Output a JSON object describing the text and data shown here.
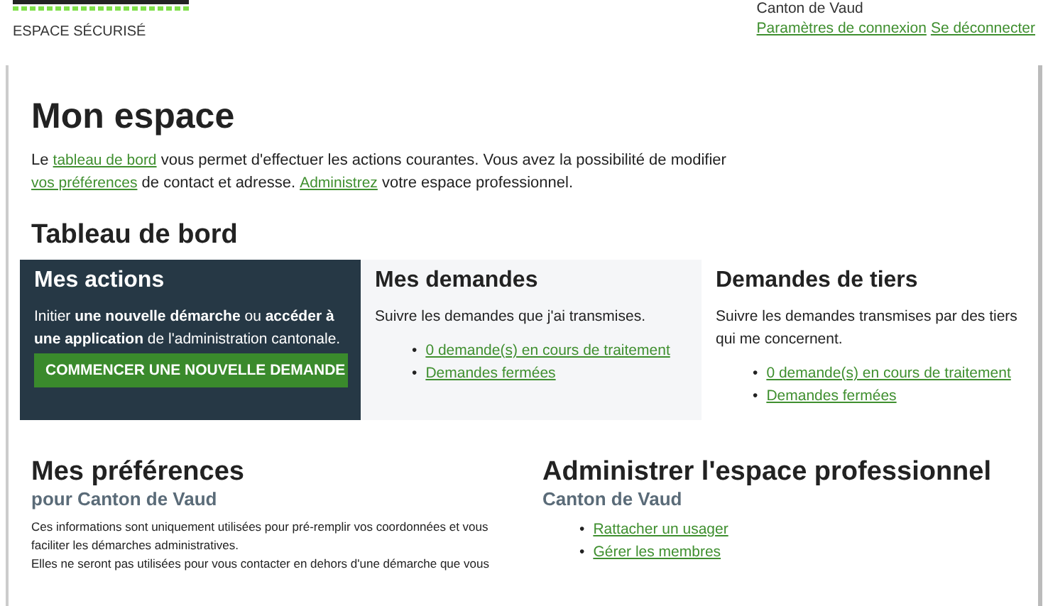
{
  "header": {
    "subtitle": "ESPACE SÉCURISÉ",
    "account": "Canton de Vaud",
    "links": [
      "Paramètres de connexion",
      "Se déconnecter"
    ]
  },
  "title": "Mon espace",
  "intro": [
    {
      "kind": "text",
      "text": "Le "
    },
    {
      "kind": "link",
      "text": "tableau de bord"
    },
    {
      "kind": "text",
      "text": " vous permet d'effectuer les actions courantes. Vous avez la possibilité de modifier "
    },
    {
      "kind": "link",
      "text": "vos préférences"
    },
    {
      "kind": "text",
      "text": " de contact et adresse. "
    },
    {
      "kind": "link",
      "text": "Administrez"
    },
    {
      "kind": "text",
      "text": " votre espace professionnel."
    }
  ],
  "dashboard": {
    "title": "Tableau de bord",
    "cards": [
      {
        "kind": "action",
        "title": "Mes actions",
        "text": "Initier **une nouvelle démarche** ou **accéder à une application** de l'administration cantonale.",
        "button": "COMMENCER UNE NOUVELLE DEMANDE"
      },
      {
        "kind": "links",
        "title": "Mes demandes",
        "text": "Suivre les demandes que j'ai transmises.",
        "bullet": "•",
        "links": [
          "0 demande(s) en cours de traitement",
          "Demandes fermées"
        ]
      },
      {
        "kind": "plain",
        "title": "Demandes de tiers",
        "text": "Suivre les demandes transmises par des tiers qui me concernent.",
        "bullet": "•",
        "links": [
          "0 demande(s) en cours de traitement",
          "Demandes fermées"
        ]
      }
    ]
  },
  "preferences": {
    "title": "Mes préférences",
    "subtitle": "pour Canton de Vaud",
    "paragraphs": [
      "Ces informations sont uniquement utilisées pour pré-remplir vos coordonnées et vous faciliter les démarches administratives.",
      "Elles ne seront pas utilisées pour vous contacter en dehors d'une démarche que vous"
    ]
  },
  "admin": {
    "title": "Administrer l'espace professionnel",
    "subtitle": "Canton de Vaud",
    "bullet": "•",
    "links": [
      "Rattacher un usager",
      "Gérer les membres"
    ]
  }
}
